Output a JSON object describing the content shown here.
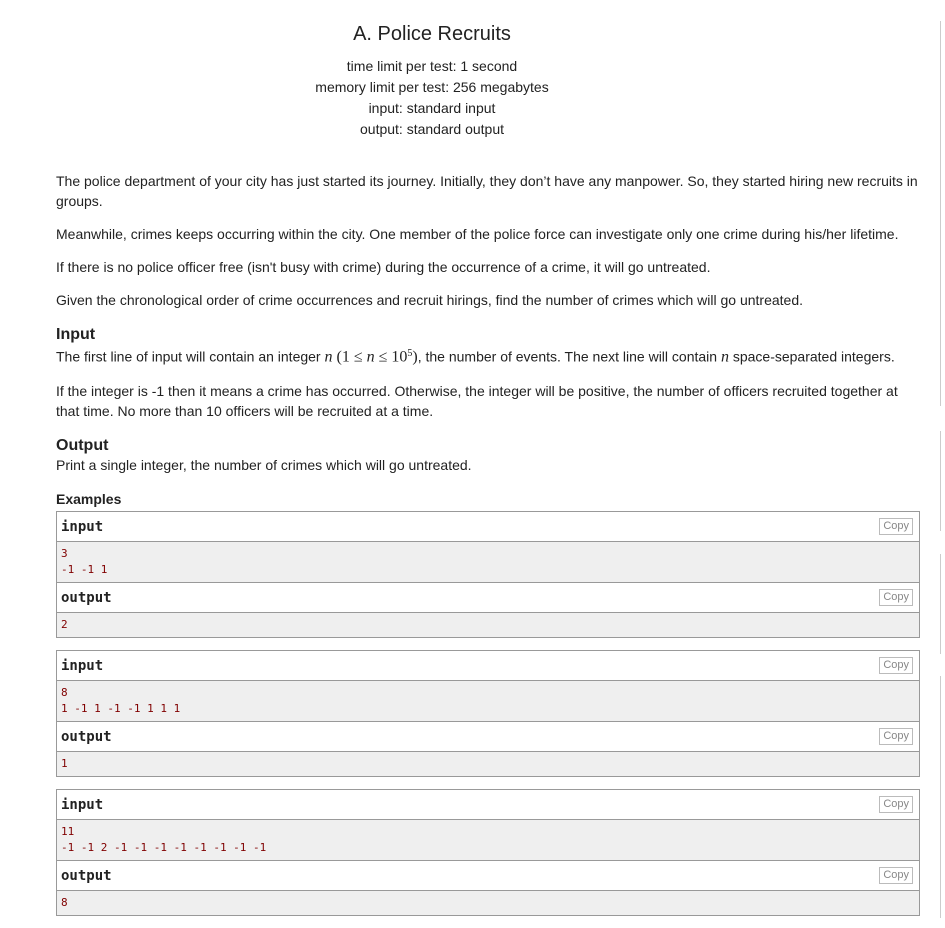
{
  "problem": {
    "title": "A. Police Recruits",
    "time_limit": "time limit per test: 1 second",
    "memory_limit": "memory limit per test: 256 megabytes",
    "input_file": "input: standard input",
    "output_file": "output: standard output"
  },
  "statement": {
    "p1": "The police department of your city has just started its journey. Initially, they don’t have any manpower. So, they started hiring new recruits in groups.",
    "p2": "Meanwhile, crimes keeps occurring within the city. One member of the police force can investigate only one crime during his/her lifetime.",
    "p3": "If there is no police officer free (isn't busy with crime) during the occurrence of a crime, it will go untreated.",
    "p4": "Given the chronological order of crime occurrences and recruit hirings, find the number of crimes which will go untreated."
  },
  "input_spec": {
    "title": "Input",
    "line1_a": "The first line of input will contain an integer ",
    "var_n": "n",
    "constraint_open": " (1 ≤ ",
    "constraint_mid": " ≤ 10",
    "constraint_exp": "5",
    "constraint_close": ")",
    "line1_b": ", the number of events. The next line will contain ",
    "line1_c": " space-separated integers.",
    "p2": "If the integer is -1 then it means a crime has occurred. Otherwise, the integer will be positive, the number of officers recruited together at that time. No more than 10 officers will be recruited at a time."
  },
  "output_spec": {
    "title": "Output",
    "text": "Print a single integer, the number of crimes which will go untreated."
  },
  "examples": {
    "title": "Examples",
    "input_label": "input",
    "output_label": "output",
    "copy_label": "Copy",
    "tests": [
      {
        "input_l1": "3",
        "input_l2": "-1 -1 1",
        "output": "2"
      },
      {
        "input_l1": "8",
        "input_l2": "1 -1 1 -1 -1 1 1 1",
        "output": "1"
      },
      {
        "input_l1": "11",
        "input_l2": "-1 -1 2 -1 -1 -1 -1 -1 -1 -1 -1",
        "output": "8"
      }
    ]
  }
}
